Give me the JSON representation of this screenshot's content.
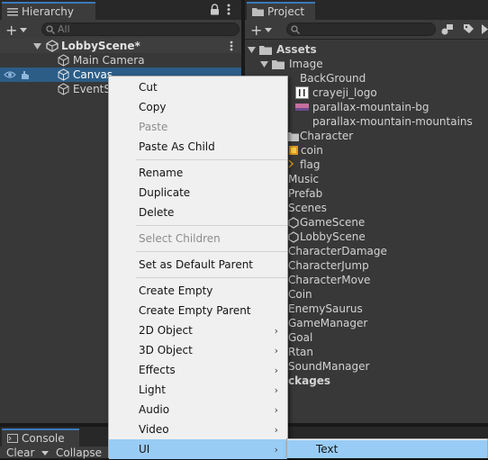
{
  "hierarchy": {
    "tab_label": "Hierarchy",
    "search_placeholder": "All",
    "scene_name": "LobbyScene*",
    "items": [
      "Main Camera",
      "Canvas",
      "EventS"
    ]
  },
  "project": {
    "tab_label": "Project",
    "root": "Assets",
    "items": [
      "Image",
      "BackGround",
      "crayeji_logo",
      "parallax-mountain-bg",
      "parallax-mountain-mountains",
      "Character",
      "coin",
      "flag",
      "Music",
      "Prefab",
      "Scenes",
      "GameScene",
      "LobbyScene",
      "CharacterDamage",
      "CharacterJump",
      "CharacterMove",
      "Coin",
      "EnemySaurus",
      "GameManager",
      "Goal",
      "Rtan",
      "SoundManager",
      "ckages"
    ]
  },
  "console": {
    "tab_label": "Console",
    "clear_label": "Clear",
    "collapse_label": "Collapse"
  },
  "context_menu": {
    "items": [
      "Cut",
      "Copy",
      "Paste",
      "Paste As Child",
      "Rename",
      "Duplicate",
      "Delete",
      "Select Children",
      "Set as Default Parent",
      "Create Empty",
      "Create Empty Parent",
      "2D Object",
      "3D Object",
      "Effects",
      "Light",
      "Audio",
      "Video",
      "UI"
    ],
    "disabled": [
      "Paste",
      "Select Children"
    ],
    "submenu_arrow": "›"
  },
  "submenu": {
    "items": [
      "Text"
    ]
  },
  "colors": {
    "panel_bg": "#383838",
    "tab_accent": "#3a79bb",
    "selection": "#2c5d87",
    "menu_bg": "#f0f0f0",
    "menu_highlight": "#99ccf5"
  }
}
